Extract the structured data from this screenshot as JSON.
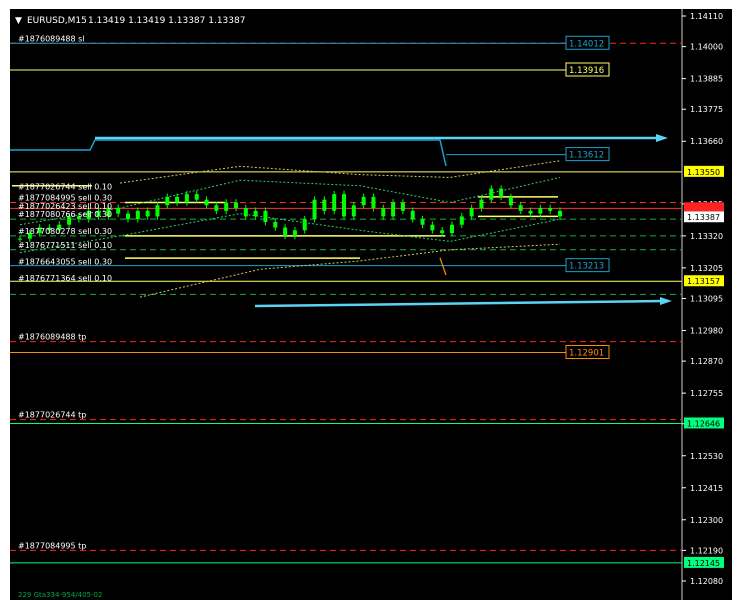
{
  "window": {
    "symbol_title": "EURUSD,M15",
    "ohlc": "1.13419 1.13419 1.13387 1.13387",
    "footer_text": "229 Gta334-954/405-02"
  },
  "colors": {
    "background": "#000000",
    "candle": "#00ff00",
    "axis_text": "#ffffff",
    "sl_line": "#ff2222",
    "tp_line": "#00ff7f",
    "blue_line": "#1aa3c9",
    "yellow_line": "#ffff66",
    "orange_line": "#ff8c00",
    "arrow": "#5bd3f5"
  },
  "chart_data": {
    "type": "candlestick",
    "title": "EURUSD,M15",
    "ylim": [
      1.1202,
      1.1413
    ],
    "y_ticks": [
      "1.14110",
      "1.14000",
      "1.13885",
      "1.13775",
      "1.13660",
      "1.13435",
      "1.13320",
      "1.13205",
      "1.13095",
      "1.12980",
      "1.12870",
      "1.12755",
      "1.12645",
      "1.12530",
      "1.12415",
      "1.12300",
      "1.12190",
      "1.12080"
    ],
    "price_labels": [
      {
        "value": "1.14012",
        "role": "line-label",
        "color": "#1aa3c9"
      },
      {
        "value": "1.13916",
        "role": "line-label",
        "color": "#ffff66"
      },
      {
        "value": "1.13612",
        "role": "line-label",
        "color": "#1aa3c9"
      },
      {
        "value": "1.13550",
        "role": "axis",
        "color": "#ffff00"
      },
      {
        "value": "1.13387",
        "role": "axis",
        "color": "#ffffff"
      },
      {
        "value": "1.13213",
        "role": "line-label",
        "color": "#1aa3c9"
      },
      {
        "value": "1.13157",
        "role": "axis",
        "color": "#ffff00"
      },
      {
        "value": "1.12901",
        "role": "line-label",
        "color": "#ff8c00"
      },
      {
        "value": "1.12646",
        "role": "axis",
        "color": "#00ff7f"
      },
      {
        "value": "1.12145",
        "role": "axis",
        "color": "#00ff7f"
      }
    ],
    "orders": [
      {
        "label": "#1876089488 sl",
        "price": 1.14012
      },
      {
        "label": "#1877026744 sell 0.10",
        "price": 1.1348
      },
      {
        "label": "#1877084995 sell 0.30",
        "price": 1.1344
      },
      {
        "label": "#1877026423 sell 0.10",
        "price": 1.1341
      },
      {
        "label": "#1877080766 sell 0.30",
        "price": 1.1338
      },
      {
        "label": "#1877080278 sell 0.30",
        "price": 1.1332
      },
      {
        "label": "#1876771511 sell 0.10",
        "price": 1.1327
      },
      {
        "label": "#1876643055 sell 0.30",
        "price": 1.1321
      },
      {
        "label": "#1876771364 sell 0.10",
        "price": 1.1315
      },
      {
        "label": "#1876089488 tp",
        "price": 1.1294
      },
      {
        "label": "#1877026744 tp",
        "price": 1.1266
      },
      {
        "label": "#1877084995 tp",
        "price": 1.1219
      }
    ],
    "candles": [
      1.1331,
      1.1333,
      1.1335,
      1.1334,
      1.1336,
      1.1339,
      1.1338,
      1.1341,
      1.1339,
      1.1342,
      1.134,
      1.1338,
      1.1341,
      1.1339,
      1.1343,
      1.1346,
      1.1344,
      1.1347,
      1.1345,
      1.1343,
      1.1341,
      1.1344,
      1.1342,
      1.1339,
      1.1341,
      1.1337,
      1.1335,
      1.1332,
      1.1334,
      1.1338,
      1.1345,
      1.1341,
      1.1347,
      1.1339,
      1.1343,
      1.1346,
      1.1342,
      1.1339,
      1.1344,
      1.1341,
      1.1338,
      1.1336,
      1.1334,
      1.1333,
      1.1336,
      1.1339,
      1.1342,
      1.1345,
      1.1349,
      1.1346,
      1.1343,
      1.1341,
      1.134,
      1.1342,
      1.1341,
      1.1339
    ]
  }
}
